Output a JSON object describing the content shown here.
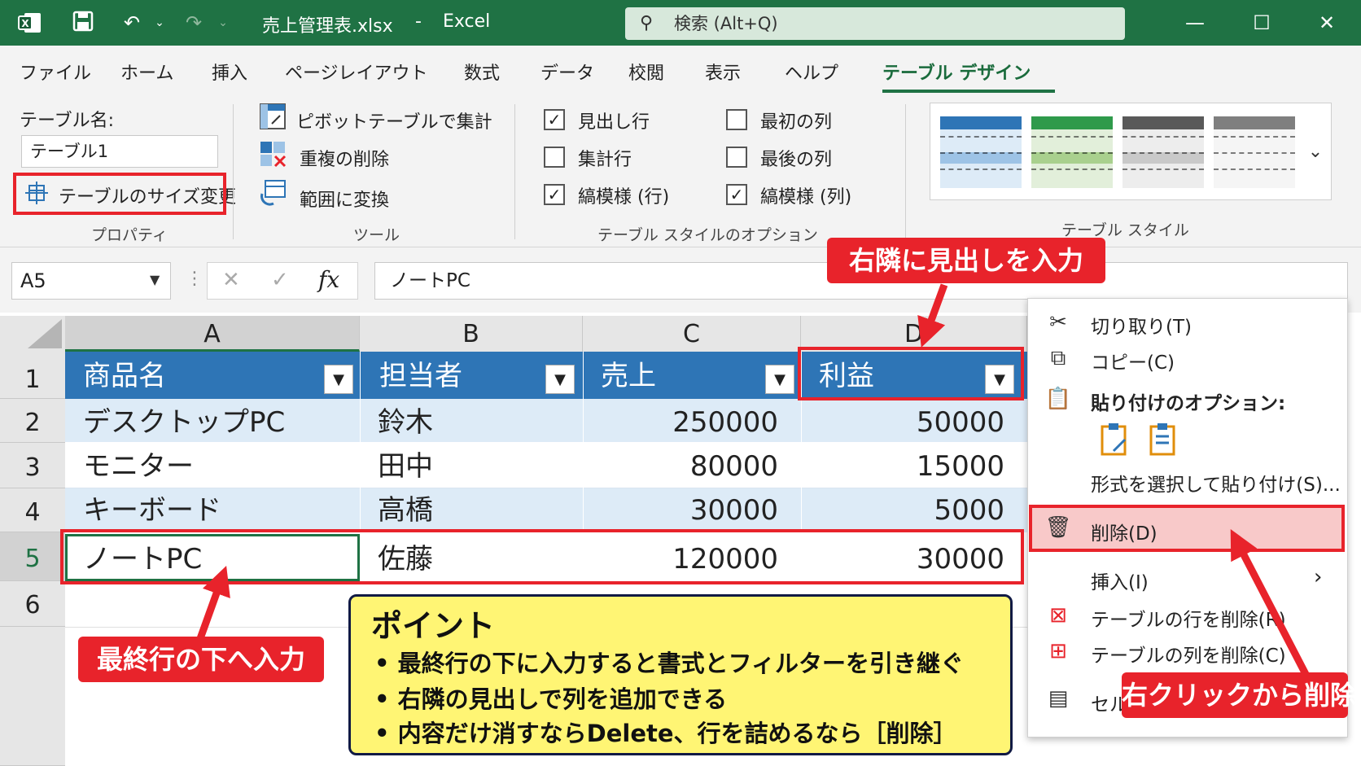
{
  "titlebar": {
    "filename": "売上管理表.xlsx",
    "dash": "-",
    "app": "Excel",
    "search_placeholder": "検索 (Alt+Q)"
  },
  "menu": [
    "ファイル",
    "ホーム",
    "挿入",
    "ページレイアウト",
    "数式",
    "データ",
    "校閲",
    "表示",
    "ヘルプ",
    "テーブル デザイン"
  ],
  "ribbon": {
    "properties": {
      "table_name_label": "テーブル名:",
      "table_name_value": "テーブル1",
      "resize_label": "テーブルのサイズ変更",
      "group_label": "プロパティ"
    },
    "tools": {
      "pivot_label": "ピボットテーブルで集計",
      "remove_dup_label": "重複の削除",
      "convert_label": "範囲に変換",
      "group_label": "ツール"
    },
    "style_options": {
      "header_row": {
        "label": "見出し行",
        "checked": true
      },
      "total_row": {
        "label": "集計行",
        "checked": false
      },
      "banded_rows": {
        "label": "縞模様 (行)",
        "checked": true
      },
      "first_col": {
        "label": "最初の列",
        "checked": false
      },
      "last_col": {
        "label": "最後の列",
        "checked": false
      },
      "banded_cols": {
        "label": "縞模様 (列)",
        "checked": true
      },
      "group_label": "テーブル スタイルのオプション"
    },
    "table_styles": {
      "group_label": "テーブル スタイル",
      "swatch_colors": [
        "#2e75b6",
        "#2f9a4b",
        "#595959",
        "#7f7f7f"
      ]
    }
  },
  "formula_bar": {
    "name_box": "A5",
    "cancel_glyph": "✕",
    "enter_glyph": "✓",
    "fx": "fx",
    "formula": "ノートPC"
  },
  "sheet": {
    "columns": [
      "A",
      "B",
      "C",
      "D"
    ],
    "rows": [
      "1",
      "2",
      "3",
      "4",
      "5",
      "6"
    ],
    "headers": [
      "商品名",
      "担当者",
      "売上",
      "利益"
    ],
    "data": [
      [
        "デスクトップPC",
        "鈴木",
        "250000",
        "50000"
      ],
      [
        "モニター",
        "田中",
        "80000",
        "15000"
      ],
      [
        "キーボード",
        "高橋",
        "30000",
        "5000"
      ],
      [
        "ノートPC",
        "佐藤",
        "120000",
        "30000"
      ]
    ]
  },
  "context_menu": {
    "cut": "切り取り(T)",
    "copy": "コピー(C)",
    "paste_options": "貼り付けのオプション:",
    "paste_special": "形式を選択して貼り付け(S)...",
    "delete": "削除(D)",
    "insert": "挿入(I)",
    "delete_table_rows": "テーブルの行を削除(R)",
    "delete_table_cols": "テーブルの列を削除(C)",
    "cell_partial": "セル"
  },
  "annotations": {
    "header_next": "右隣に見出しを入力",
    "below_last": "最終行の下へ入力",
    "right_click_delete": "右クリックから削除",
    "point_title": "ポイント",
    "point_lines": [
      "• 最終行の下に入力すると書式とフィルターを引き継ぐ",
      "• 右隣の見出しで列を追加できる",
      "• 内容だけ消すならDelete、行を詰めるなら［削除］"
    ]
  }
}
